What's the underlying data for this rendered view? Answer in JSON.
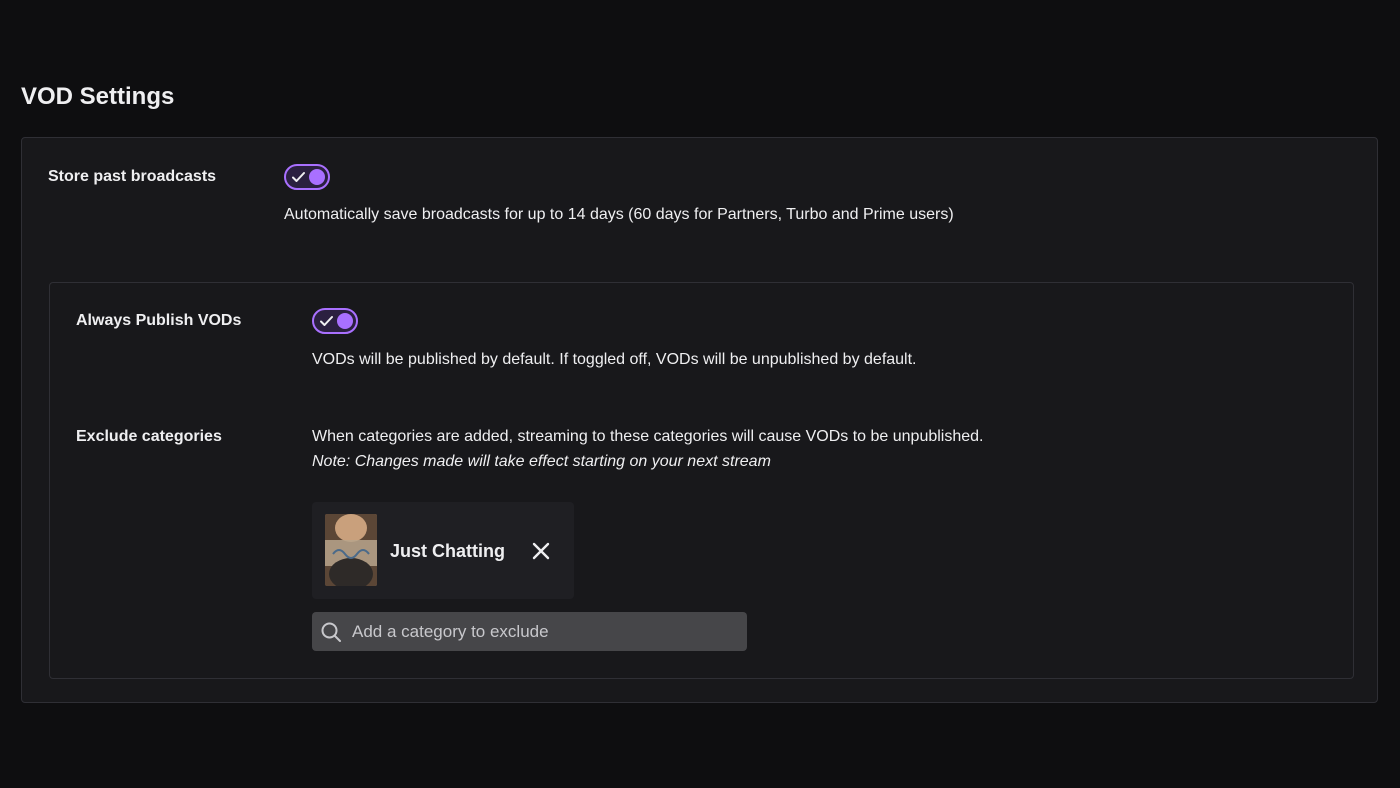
{
  "section": {
    "title": "VOD Settings"
  },
  "store_past_broadcasts": {
    "label": "Store past broadcasts",
    "enabled": true,
    "description": "Automatically save broadcasts for up to 14 days (60 days for Partners, Turbo and Prime users)"
  },
  "always_publish": {
    "label": "Always Publish VODs",
    "enabled": true,
    "description": "VODs will be published by default. If toggled off, VODs will be unpublished by default."
  },
  "exclude_categories": {
    "label": "Exclude categories",
    "description": "When categories are added, streaming to these categories will cause VODs to be unpublished.",
    "note": "Note: Changes made will take effect starting on your next stream",
    "categories": [
      {
        "name": "Just Chatting"
      }
    ],
    "search_placeholder": "Add a category to exclude"
  },
  "colors": {
    "background": "#0e0e10",
    "card": "#18181b",
    "accent": "#a970ff",
    "search_field": "#464649"
  }
}
